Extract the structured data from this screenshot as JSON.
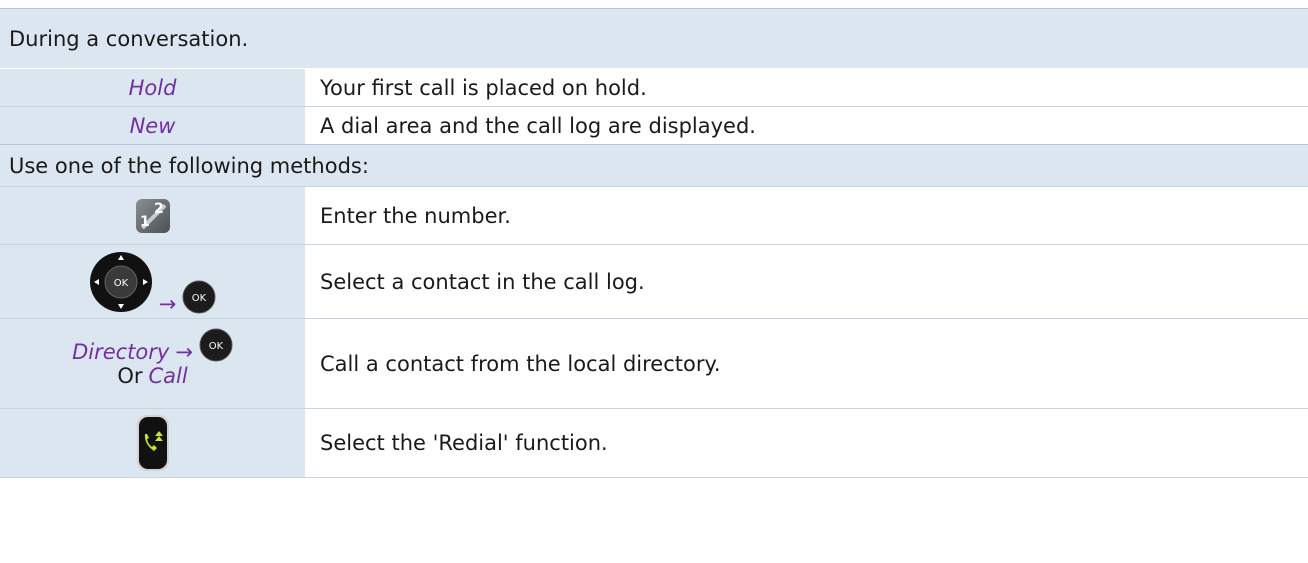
{
  "sections": {
    "during": "During a conversation.",
    "methods": "Use one of the following methods:"
  },
  "rows": {
    "hold": {
      "key": "Hold",
      "desc": "Your first call is placed on hold."
    },
    "new": {
      "key": "New",
      "desc": "A dial area and the call log are displayed."
    },
    "keypad": {
      "icon": "keypad-icon",
      "desc": "Enter the number."
    },
    "nav": {
      "icon": "navigator-ok-icon",
      "arrow": "→",
      "ok_label": "OK",
      "desc": "Select a contact in the call log."
    },
    "directory": {
      "key1": "Directory",
      "arrow": "→",
      "ok_label": "OK",
      "or": "Or",
      "key2": "Call",
      "desc": "Call a contact from the local directory."
    },
    "redial": {
      "icon": "redial-key-icon",
      "desc": "Select the 'Redial' function."
    }
  },
  "colors": {
    "section_bg": "#dce6f1",
    "keyword": "#7030a0",
    "ok_button": "#1c1c1c",
    "redial_green": "#c6e629"
  }
}
